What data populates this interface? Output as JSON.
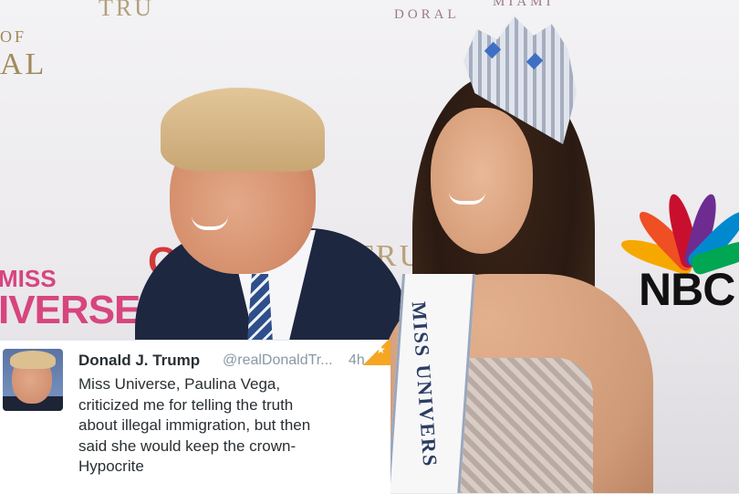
{
  "backdrop": {
    "trump_top": "TRU",
    "of": "OF",
    "al": "AL",
    "doral": "DORAL",
    "miami": "MIAMI",
    "trump_mid": "TRUM",
    "ca": "CA",
    "miss": "MISS",
    "universe": "IVERSE",
    "nbc": "NBC"
  },
  "sash_text": "MISS UNIVERS",
  "tweet": {
    "name": "Donald J. Trump",
    "handle": "@realDonaldTr...",
    "time": "4h",
    "lines": [
      "Miss Universe, Paulina Vega,",
      "criticized me for telling the truth",
      "about illegal immigration, but then",
      "said she would keep the crown-",
      "Hypocrite"
    ]
  },
  "colors": {
    "peacock": [
      "#f6a800",
      "#f04e23",
      "#c8102e",
      "#6e2c91",
      "#0089cf",
      "#00a651"
    ]
  }
}
